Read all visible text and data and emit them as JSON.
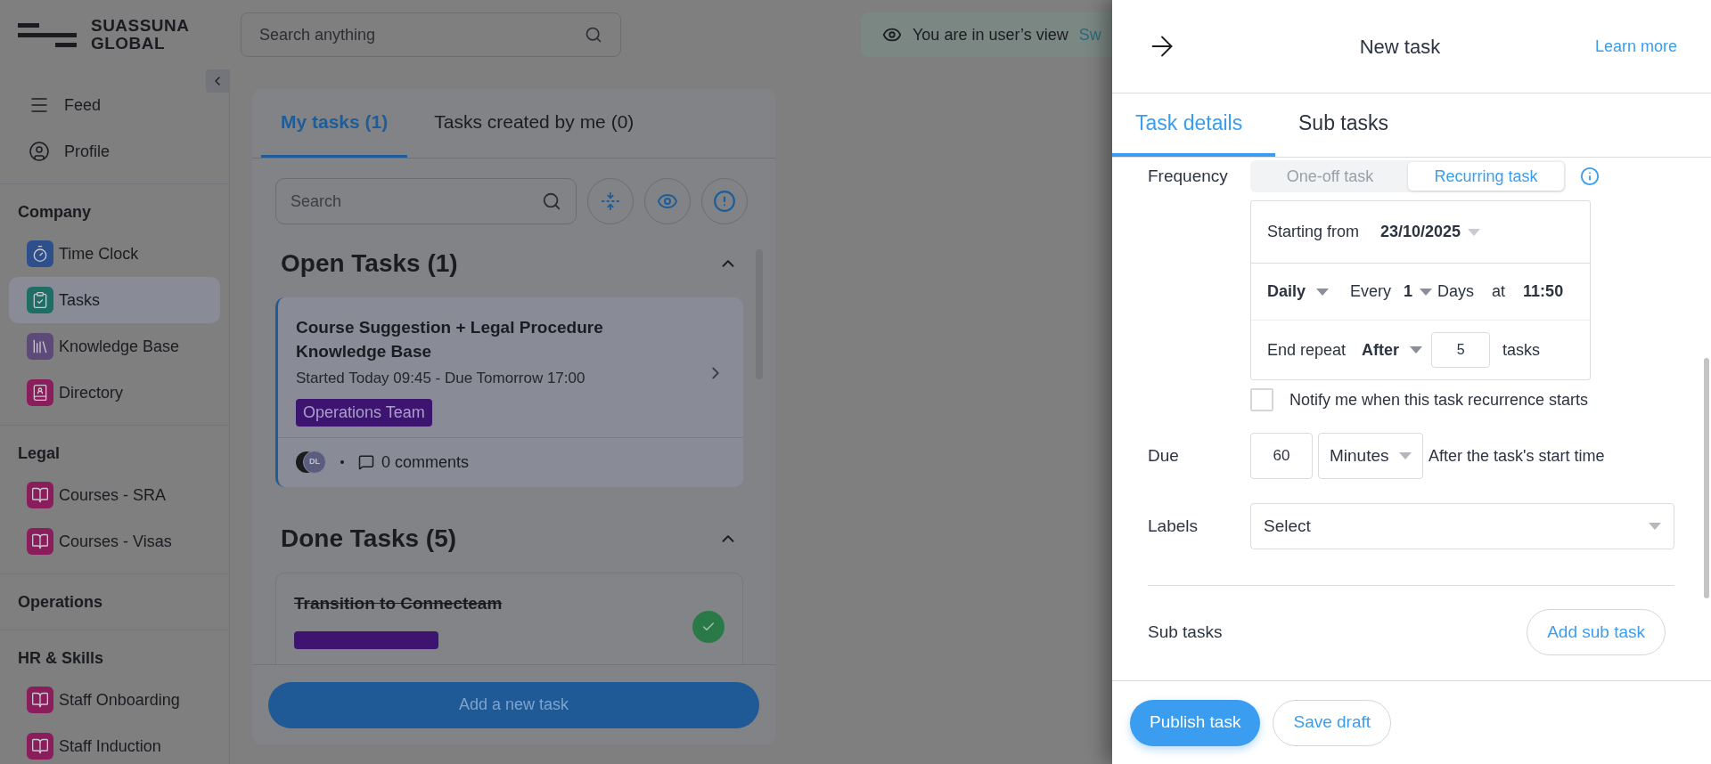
{
  "header": {
    "logo_line1": "SUASSUNA",
    "logo_line2": "GLOBAL",
    "search_placeholder": "Search anything",
    "view_notice": "You are in user’s view",
    "view_link": "Sw"
  },
  "sidebar": {
    "top_items": [
      {
        "label": "Feed",
        "kind": "menu"
      },
      {
        "label": "Profile",
        "kind": "user"
      }
    ],
    "sections": [
      {
        "title": "Company",
        "items": [
          {
            "label": "Time Clock",
            "kind": "timer",
            "color": "#2d4f8c",
            "selected": false
          },
          {
            "label": "Tasks",
            "kind": "tasks",
            "color": "#1f6e66",
            "selected": true
          },
          {
            "label": "Knowledge Base",
            "kind": "library",
            "color": "#5e4a78",
            "selected": false
          },
          {
            "label": "Directory",
            "kind": "directory",
            "color": "#8a1e5c",
            "selected": false
          }
        ]
      },
      {
        "title": "Legal",
        "items": [
          {
            "label": "Courses - SRA",
            "kind": "book",
            "color": "#8a1e5c",
            "selected": false
          },
          {
            "label": "Courses - Visas",
            "kind": "book",
            "color": "#8a1e5c",
            "selected": false
          }
        ]
      },
      {
        "title": "Operations"
      },
      {
        "title": "HR & Skills",
        "items": [
          {
            "label": "Staff Onboarding",
            "kind": "book",
            "color": "#8a1e5c",
            "selected": false
          },
          {
            "label": "Staff Induction",
            "kind": "book",
            "color": "#8a1e5c",
            "selected": false
          }
        ]
      }
    ]
  },
  "main": {
    "tabs": [
      {
        "label": "My tasks (1)",
        "selected": true
      },
      {
        "label": "Tasks created by me (0)",
        "selected": false
      }
    ],
    "search_placeholder": "Search",
    "groups": [
      {
        "title": "Open Tasks (1)",
        "expanded": true,
        "tasks": [
          {
            "title": "Course Suggestion + Legal Procedure Knowledge Base",
            "subtitle": "Started Today 09:45 - Due Tomorrow 17:00",
            "tag": "Operations Team",
            "avatar": "DL",
            "comments": "0 comments",
            "done": false
          }
        ]
      },
      {
        "title": "Done Tasks (5)",
        "expanded": true,
        "tasks": [
          {
            "title": "Transition to Connecteam",
            "done": true
          }
        ]
      }
    ],
    "add_button": "Add a new task"
  },
  "drawer": {
    "title": "New task",
    "learn_more": "Learn more",
    "tabs": [
      {
        "label": "Task details",
        "selected": true
      },
      {
        "label": "Sub tasks",
        "selected": false
      }
    ],
    "frequency": {
      "label": "Frequency",
      "options": [
        {
          "label": "One-off task",
          "selected": false
        },
        {
          "label": "Recurring task",
          "selected": true
        }
      ]
    },
    "recurrence": {
      "starting_label": "Starting from",
      "starting_value": "23/10/2025",
      "period": "Daily",
      "every_label": "Every",
      "every_value": "1",
      "unit": "Days",
      "at_label": "at",
      "time": "11:50",
      "end_label": "End repeat",
      "end_mode": "After",
      "end_count": "5",
      "end_unit": "tasks"
    },
    "notify": {
      "label": "Notify me when this task recurrence starts",
      "checked": false
    },
    "due": {
      "label": "Due",
      "value": "60",
      "unit": "Minutes",
      "suffix": "After the task's start time"
    },
    "labels": {
      "label": "Labels",
      "placeholder": "Select"
    },
    "subtasks": {
      "label": "Sub tasks",
      "button": "Add sub task"
    },
    "publish": "Publish task",
    "save": "Save draft"
  }
}
